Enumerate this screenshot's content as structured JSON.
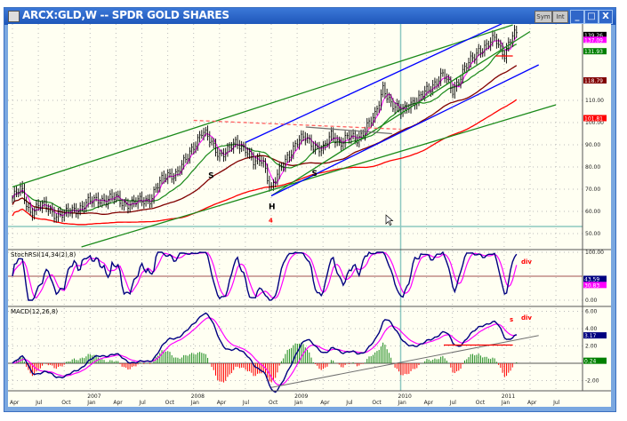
{
  "window": {
    "title": "ARCX:GLD,W -- SPDR GOLD SHARES",
    "buttons": [
      "Sym",
      "Int"
    ],
    "controls": {
      "minimize": "_",
      "maximize": "□",
      "close": "X"
    }
  },
  "chart_data": [
    {
      "type": "candlestick-bar",
      "panel": "price",
      "frequency": "weekly",
      "x_ticks": [
        {
          "label": "Apr",
          "date": "2006-04"
        },
        {
          "label": "Jul",
          "date": "2006-07"
        },
        {
          "label": "Oct",
          "date": "2006-10"
        },
        {
          "label": "Jan",
          "year": "2007",
          "date": "2007-01"
        },
        {
          "label": "Apr",
          "date": "2007-04"
        },
        {
          "label": "Jul",
          "date": "2007-07"
        },
        {
          "label": "Oct",
          "date": "2007-10"
        },
        {
          "label": "Jan",
          "year": "2008",
          "date": "2008-01"
        },
        {
          "label": "Apr",
          "date": "2008-04"
        },
        {
          "label": "Jul",
          "date": "2008-07"
        },
        {
          "label": "Oct",
          "date": "2008-10"
        },
        {
          "label": "Jan",
          "year": "2009",
          "date": "2009-01"
        },
        {
          "label": "Apr",
          "date": "2009-04"
        },
        {
          "label": "Jul",
          "date": "2009-07"
        },
        {
          "label": "Oct",
          "date": "2009-10"
        },
        {
          "label": "Jan",
          "year": "2010",
          "date": "2010-01"
        },
        {
          "label": "Apr",
          "date": "2010-04"
        },
        {
          "label": "Jul",
          "date": "2010-07"
        },
        {
          "label": "Oct",
          "date": "2010-10"
        },
        {
          "label": "Jan",
          "year": "2011",
          "date": "2011-01"
        },
        {
          "label": "Apr",
          "date": "2011-04"
        },
        {
          "label": "Jul",
          "date": "2011-07"
        }
      ],
      "y_ticks": [
        "50.00",
        "60.00",
        "70.00",
        "80.00",
        "90.00",
        "100.00",
        "110.00"
      ],
      "ylim": [
        47,
        145
      ],
      "monthly_closes": {
        "start": "2006-04",
        "values": [
          66,
          70,
          60,
          62,
          62,
          59,
          58,
          61,
          62,
          64,
          66,
          65,
          66,
          64,
          63,
          65,
          66,
          72,
          77,
          77,
          82,
          90,
          96,
          91,
          86,
          87,
          91,
          89,
          81,
          84,
          70,
          78,
          86,
          91,
          93,
          90,
          87,
          95,
          91,
          93,
          93,
          98,
          102,
          117,
          107,
          105,
          109,
          109,
          115,
          118,
          121,
          115,
          121,
          127,
          133,
          134,
          138,
          131,
          139
        ]
      },
      "value_labels": [
        {
          "value": "139.26",
          "series": "price",
          "color": "#000000"
        },
        {
          "value": "137.09",
          "series": "ma-short",
          "color": "#ff00ff"
        },
        {
          "value": "131.93",
          "series": "ma-medium",
          "color": "#008000"
        },
        {
          "value": "118.79",
          "series": "ma-long",
          "color": "#800000"
        },
        {
          "value": "101.81",
          "series": "ma-longest",
          "color": "#ff0000"
        }
      ],
      "trendlines": [
        {
          "from": [
            "2006-04",
            71
          ],
          "to": [
            "2011-02",
            144
          ],
          "color": "#1a8a1a"
        },
        {
          "from": [
            "2006-12",
            44
          ],
          "to": [
            "2011-07",
            108
          ],
          "color": "#1a8a1a"
        },
        {
          "from": [
            "2008-10",
            67
          ],
          "to": [
            "2011-04",
            141
          ],
          "color": "#1a8a1a"
        },
        {
          "from": [
            "2008-07",
            91
          ],
          "to": [
            "2011-01",
            145
          ],
          "color": "#0000ff"
        },
        {
          "from": [
            "2008-10",
            67
          ],
          "to": [
            "2011-05",
            126
          ],
          "color": "#0000ff"
        },
        {
          "from": [
            "2008-01",
            101
          ],
          "to": [
            "2010-01",
            97
          ],
          "color": "#ff6060",
          "dashed": true
        },
        {
          "from": [
            "2009-02",
            98
          ],
          "to": [
            "2009-12",
            95
          ],
          "color": "#707070"
        },
        {
          "from": [
            "2010-12",
            130
          ],
          "to": [
            "2011-02",
            130
          ],
          "color": "#ff0000"
        }
      ],
      "annotations": [
        {
          "text": "S",
          "at": [
            "2008-03",
            75
          ],
          "color": "#000000"
        },
        {
          "text": "H",
          "at": [
            "2008-10",
            61
          ],
          "color": "#000000"
        },
        {
          "text": "S",
          "at": [
            "2009-03",
            76
          ],
          "color": "#000000"
        },
        {
          "text": "4",
          "at": [
            "2008-10",
            55
          ],
          "color": "#ff0000"
        }
      ]
    },
    {
      "type": "line",
      "panel": "stochastic",
      "title": "StochRSI(14,34(2),8)",
      "y_ticks": [
        "100.00",
        "0.00"
      ],
      "ylim": [
        0,
        100
      ],
      "value_labels": [
        {
          "value": "43.59",
          "color": "#000080"
        },
        {
          "value": "30.83",
          "color": "#ff00ff"
        }
      ],
      "annotations": [
        {
          "text": "div",
          "color": "#ff0000"
        }
      ]
    },
    {
      "type": "line+histogram",
      "panel": "macd",
      "title": "MACD(12,26,8)",
      "y_ticks": [
        "6.00",
        "4.00",
        "2.00",
        "-2.00"
      ],
      "ylim": [
        -3,
        6.5
      ],
      "value_labels": [
        {
          "value": "3.17",
          "color": "#000080"
        },
        {
          "value": "0.24",
          "color": "#008000"
        }
      ],
      "annotations": [
        {
          "text": "s",
          "color": "#ff0000"
        },
        {
          "text": "div",
          "color": "#ff0000"
        }
      ]
    }
  ]
}
